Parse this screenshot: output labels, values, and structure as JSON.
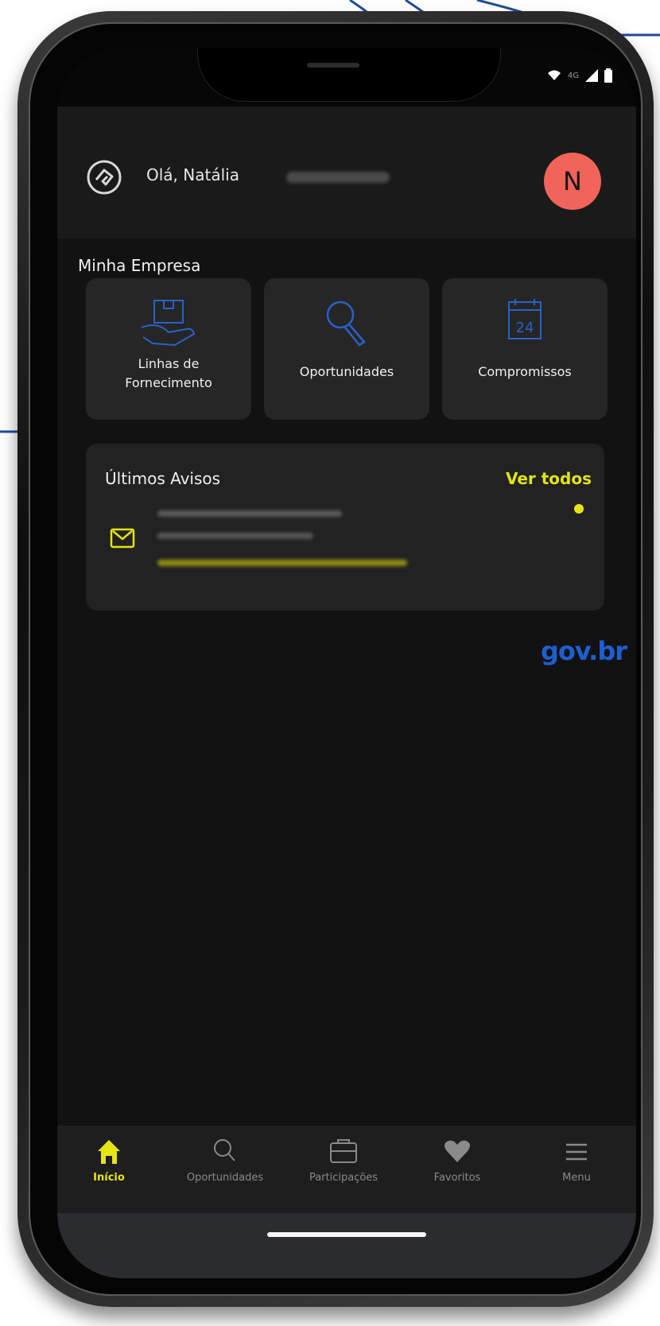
{
  "status_bar": {
    "network_label": "4G"
  },
  "header": {
    "greeting": "Olá, Natália",
    "avatar_initial": "N"
  },
  "section": {
    "title": "Minha Empresa"
  },
  "tiles": [
    {
      "label": "Linhas de Fornecimento",
      "icon": "hand-box-icon"
    },
    {
      "label": "Oportunidades",
      "icon": "search-icon"
    },
    {
      "label": "Compromissos",
      "icon": "calendar-icon",
      "calendar_day": "24"
    }
  ],
  "avisos": {
    "title": "Últimos Avisos",
    "see_all": "Ver todos"
  },
  "brand": {
    "label": "gov.br"
  },
  "bottom_nav": [
    {
      "label": "Início",
      "icon": "home-icon",
      "active": true
    },
    {
      "label": "Oportunidades",
      "icon": "search-icon",
      "active": false
    },
    {
      "label": "Participações",
      "icon": "briefcase-icon",
      "active": false
    },
    {
      "label": "Favoritos",
      "icon": "heart-icon",
      "active": false
    },
    {
      "label": "Menu",
      "icon": "menu-icon",
      "active": false
    }
  ],
  "colors": {
    "accent_yellow": "#e6e414",
    "avatar_bg": "#f0645a",
    "brand_blue": "#1d5fd1",
    "icon_blue": "#2a61c8"
  }
}
